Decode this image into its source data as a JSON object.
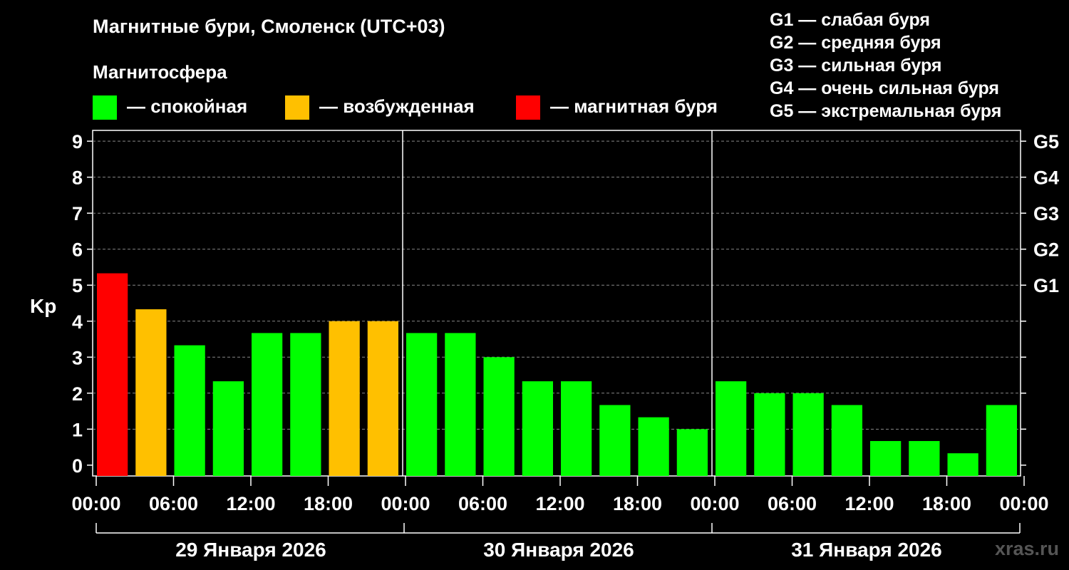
{
  "header": {
    "title": "Магнитные бури, Смоленск (UTC+03)",
    "subtitle": "Магнитосфера",
    "legend": [
      {
        "label": "— спокойная",
        "color": "#00ff00"
      },
      {
        "label": "— возбужденная",
        "color": "#ffc000"
      },
      {
        "label": "— магнитная буря",
        "color": "#ff0000"
      }
    ],
    "storm_levels": [
      "G1 — слабая буря",
      "G2 — средняя буря",
      "G3 — сильная буря",
      "G4 — очень сильная буря",
      "G5 — экстремальная буря"
    ]
  },
  "credit": "xras.ru",
  "chart_data": {
    "type": "bar",
    "ylabel": "Kp",
    "ylim": [
      -0.3,
      9.3
    ],
    "y_ticks": [
      "0",
      "1",
      "2",
      "3",
      "4",
      "5",
      "6",
      "7",
      "8",
      "9"
    ],
    "right_ticks": [
      "G1",
      "G2",
      "G3",
      "G4",
      "G5"
    ],
    "x_tick_labels": [
      "00:00",
      "06:00",
      "12:00",
      "18:00",
      "00:00",
      "06:00",
      "12:00",
      "18:00",
      "00:00",
      "06:00",
      "12:00",
      "18:00",
      "00:00"
    ],
    "days": [
      "29 Января 2026",
      "30 Января 2026",
      "31 Января 2026"
    ],
    "grid": true,
    "legend_position": "top",
    "colors": {
      "quiet": "#00ff00",
      "active": "#ffc000",
      "storm": "#ff0000"
    },
    "values": [
      5.33,
      4.33,
      3.33,
      2.33,
      3.67,
      3.67,
      4.0,
      4.0,
      3.67,
      3.67,
      3.0,
      2.33,
      2.33,
      1.67,
      1.33,
      1.0,
      2.33,
      2.0,
      2.0,
      1.67,
      0.67,
      0.67,
      0.33,
      1.67
    ],
    "categories": [
      "quiet",
      "active",
      "storm"
    ],
    "bar_levels": [
      "storm",
      "active",
      "quiet",
      "quiet",
      "quiet",
      "quiet",
      "active",
      "active",
      "quiet",
      "quiet",
      "quiet",
      "quiet",
      "quiet",
      "quiet",
      "quiet",
      "quiet",
      "quiet",
      "quiet",
      "quiet",
      "quiet",
      "quiet",
      "quiet",
      "quiet",
      "quiet"
    ]
  }
}
